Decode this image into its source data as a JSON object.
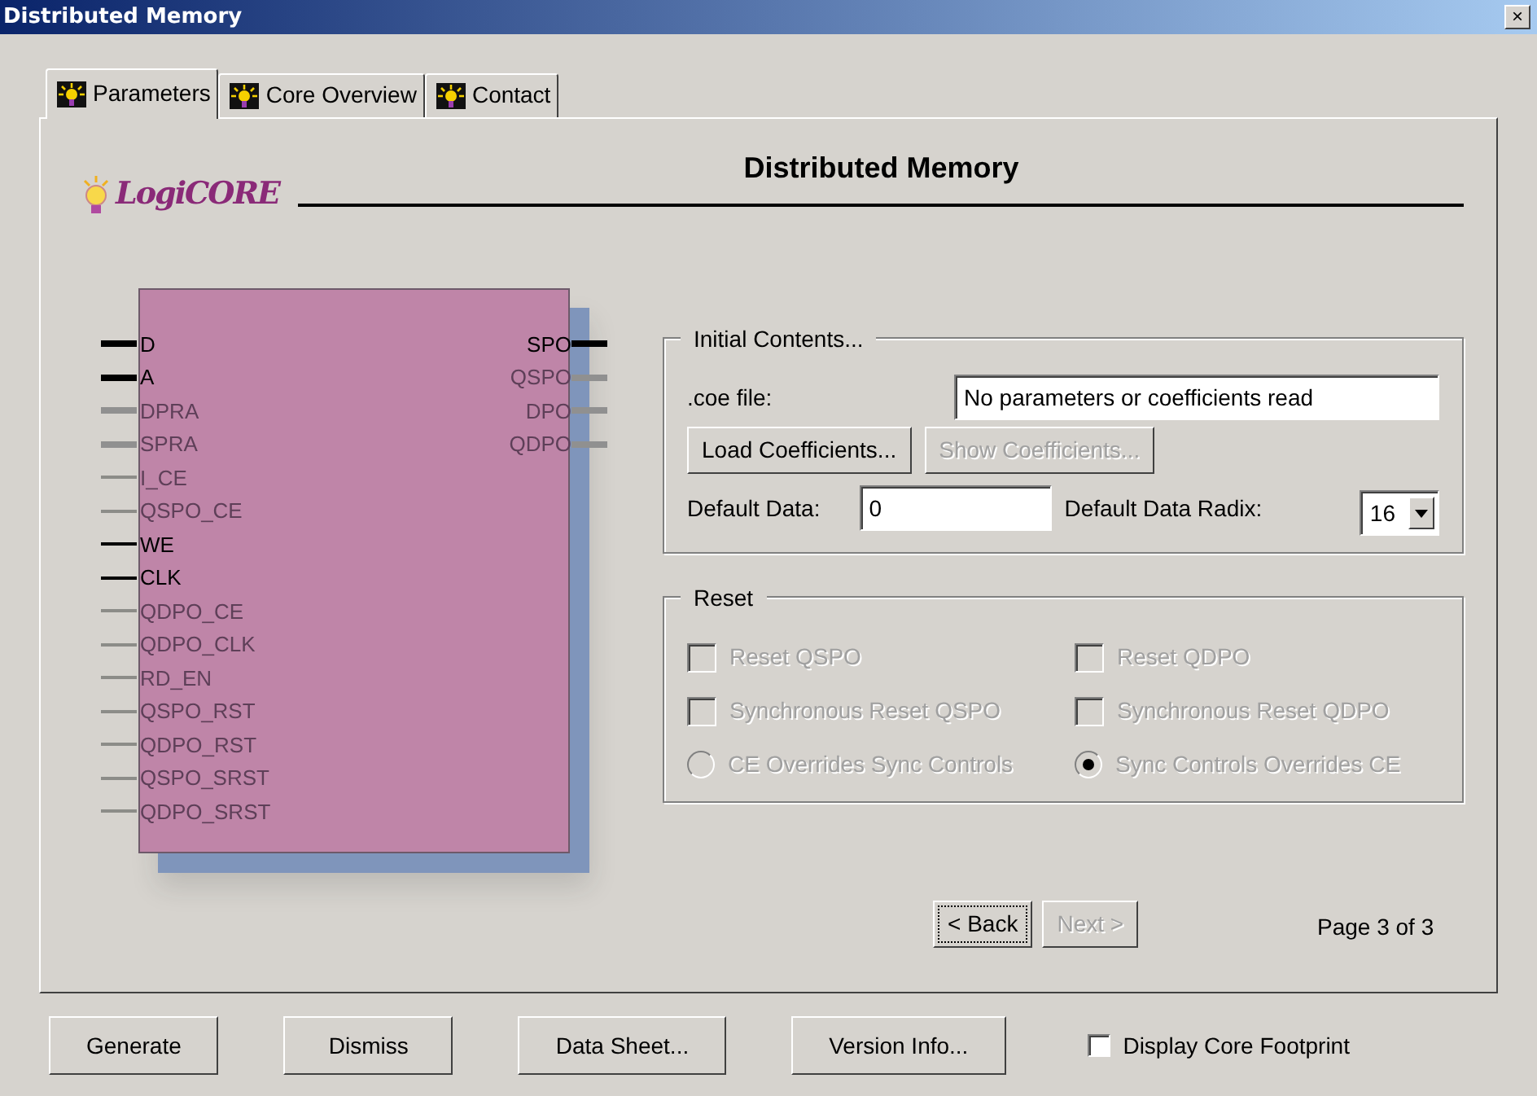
{
  "window": {
    "title": "Distributed Memory",
    "close": "×"
  },
  "tabs": [
    {
      "label": "Parameters",
      "selected": true
    },
    {
      "label": "Core Overview",
      "selected": false
    },
    {
      "label": "Contact",
      "selected": false
    }
  ],
  "header": {
    "logo": "LogiCORE",
    "title": "Distributed Memory"
  },
  "symbol": {
    "inputs": [
      {
        "name": "D",
        "enabled": true,
        "kind": "bus"
      },
      {
        "name": "A",
        "enabled": true,
        "kind": "bus"
      },
      {
        "name": "DPRA",
        "enabled": false,
        "kind": "bus"
      },
      {
        "name": "SPRA",
        "enabled": false,
        "kind": "bus"
      },
      {
        "name": "I_CE",
        "enabled": false,
        "kind": "wire"
      },
      {
        "name": "QSPO_CE",
        "enabled": false,
        "kind": "wire"
      },
      {
        "name": "WE",
        "enabled": true,
        "kind": "wire"
      },
      {
        "name": "CLK",
        "enabled": true,
        "kind": "wire"
      },
      {
        "name": "QDPO_CE",
        "enabled": false,
        "kind": "wire"
      },
      {
        "name": "QDPO_CLK",
        "enabled": false,
        "kind": "wire"
      },
      {
        "name": "RD_EN",
        "enabled": false,
        "kind": "wire"
      },
      {
        "name": "QSPO_RST",
        "enabled": false,
        "kind": "wire"
      },
      {
        "name": "QDPO_RST",
        "enabled": false,
        "kind": "wire"
      },
      {
        "name": "QSPO_SRST",
        "enabled": false,
        "kind": "wire"
      },
      {
        "name": "QDPO_SRST",
        "enabled": false,
        "kind": "wire"
      }
    ],
    "outputs": [
      {
        "name": "SPO",
        "enabled": true,
        "kind": "bus"
      },
      {
        "name": "QSPO",
        "enabled": false,
        "kind": "bus"
      },
      {
        "name": "DPO",
        "enabled": false,
        "kind": "bus"
      },
      {
        "name": "QDPO",
        "enabled": false,
        "kind": "bus"
      }
    ]
  },
  "initial_contents": {
    "title": "Initial Contents...",
    "coe_label": ".coe file:",
    "coe_value": "No parameters or coefficients read",
    "buttons": [
      {
        "label": "Load Coefficients...",
        "disabled": false
      },
      {
        "label": "Show Coefficients...",
        "disabled": true
      }
    ],
    "default_data_label": "Default Data:",
    "default_data_value": "0",
    "radix_label": "Default Data Radix:",
    "radix_value": "16"
  },
  "reset": {
    "title": "Reset",
    "options": [
      {
        "kind": "checkbox",
        "label": "Reset QSPO",
        "checked": false,
        "disabled": true
      },
      {
        "kind": "checkbox",
        "label": "Reset QDPO",
        "checked": false,
        "disabled": true
      },
      {
        "kind": "checkbox",
        "label": "Synchronous Reset QSPO",
        "checked": false,
        "disabled": true
      },
      {
        "kind": "checkbox",
        "label": "Synchronous Reset QDPO",
        "checked": false,
        "disabled": true
      },
      {
        "kind": "radio",
        "label": "CE Overrides Sync Controls",
        "checked": false,
        "disabled": true
      },
      {
        "kind": "radio",
        "label": "Sync Controls Overrides CE",
        "checked": true,
        "disabled": true
      }
    ]
  },
  "navigation": {
    "buttons": [
      {
        "label": "< Back",
        "disabled": false,
        "focused": true
      },
      {
        "label": "Next >",
        "disabled": true,
        "focused": false
      }
    ],
    "page": "Page 3 of 3"
  },
  "footer": {
    "buttons": [
      "Generate",
      "Dismiss",
      "Data Sheet...",
      "Version Info..."
    ],
    "checkbox": {
      "label": "Display Core Footprint",
      "checked": false
    }
  }
}
